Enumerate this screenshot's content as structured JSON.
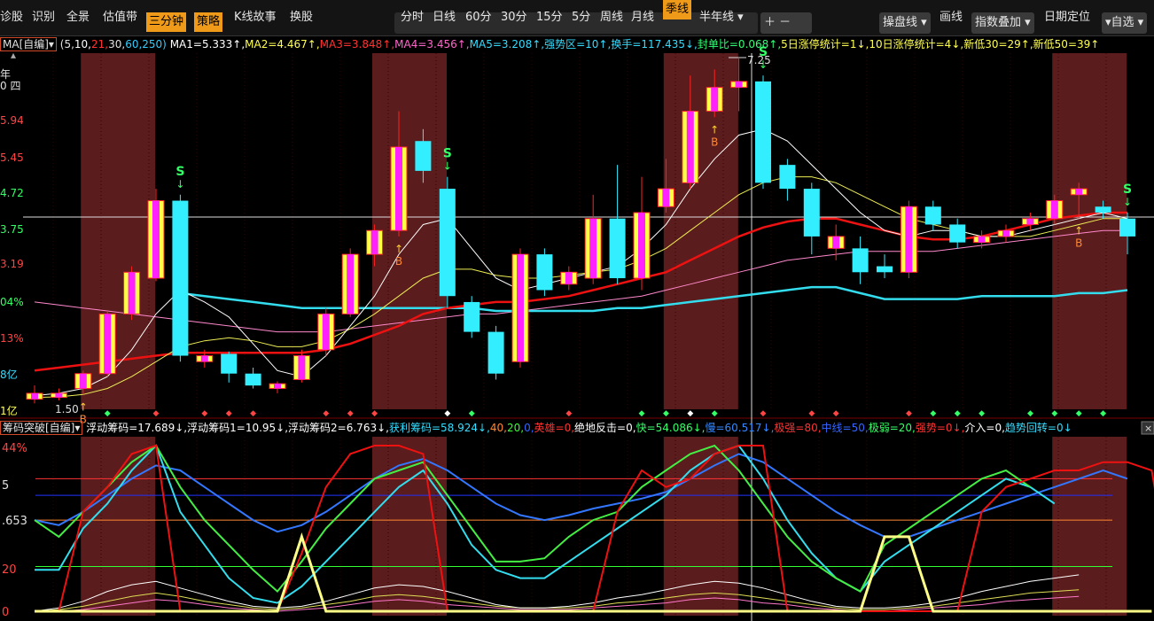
{
  "toolbar": {
    "left": [
      "诊股",
      "识别",
      "全景",
      "估值带",
      "三分钟",
      "策略",
      "K线故事",
      "换股"
    ],
    "active_left": [
      "三分钟",
      "策略"
    ],
    "periods": [
      "分时",
      "日线",
      "60分",
      "30分",
      "15分",
      "5分",
      "周线",
      "月线",
      "季线",
      "半年线"
    ],
    "active_period": "季线",
    "right": {
      "caopan": "操盘线",
      "huaxian": "画线",
      "zhishu": "指数叠加",
      "riqi": "日期定位",
      "zixuan": "自选"
    }
  },
  "legend_main": [
    {
      "t": "MA[自编]",
      "c": "#e0e0e0",
      "box": true
    },
    {
      "t": " (5,",
      "c": "#e0e0e0"
    },
    {
      "t": "10,",
      "c": "#ffffff"
    },
    {
      "t": "21,",
      "c": "#ff3333"
    },
    {
      "t": "30,",
      "c": "#e0e0e0"
    },
    {
      "t": "60,",
      "c": "#33ccff"
    },
    {
      "t": "250)",
      "c": "#33ccff"
    },
    {
      "t": "  MA1=5.333↑,",
      "c": "#ffffff"
    },
    {
      "t": "MA2=4.467↑,",
      "c": "#ffff55"
    },
    {
      "t": "MA3=3.848↑,",
      "c": "#ff3333"
    },
    {
      "t": "MA4=3.456↑,",
      "c": "#ff66cc"
    },
    {
      "t": "MA5=3.208↑,",
      "c": "#33ddff"
    },
    {
      "t": "强势区=10↑,",
      "c": "#33ddff"
    },
    {
      "t": "换手=117.435↓,",
      "c": "#33ddff"
    },
    {
      "t": "封单比=0.068↑,",
      "c": "#33ff77"
    },
    {
      "t": "5日涨停统计=1↓,",
      "c": "#ffff55"
    },
    {
      "t": "10日涨停统计=4↓,",
      "c": "#ffff55"
    },
    {
      "t": "新低30=29↑,",
      "c": "#ffff55"
    },
    {
      "t": "新低50=39↑",
      "c": "#ffff55"
    }
  ],
  "legend_ind": [
    {
      "t": "筹码突破[自编]",
      "c": "#e6e6e6",
      "box": true
    },
    {
      "t": " 浮动筹码=17.689↓,",
      "c": "#ffffff"
    },
    {
      "t": "浮动筹码1=10.95↓,",
      "c": "#ffffff"
    },
    {
      "t": "浮动筹码2=6.763↓,",
      "c": "#ffffff"
    },
    {
      "t": "获利筹码=58.924↓,",
      "c": "#33ddff"
    },
    {
      "t": "40,",
      "c": "#ff8833"
    },
    {
      "t": "20,",
      "c": "#33ff33"
    },
    {
      "t": "0,",
      "c": "#3366ff"
    },
    {
      "t": "英雄=0,",
      "c": "#ff3333"
    },
    {
      "t": "绝地反击=0,",
      "c": "#ffffff"
    },
    {
      "t": "快=54.086↓,",
      "c": "#33ff66"
    },
    {
      "t": "慢=60.517↓,",
      "c": "#3388ff"
    },
    {
      "t": "极强=80,",
      "c": "#ff3333"
    },
    {
      "t": "中线=50,",
      "c": "#3366ff"
    },
    {
      "t": "极弱=20,",
      "c": "#33ff66"
    },
    {
      "t": "强势=0↓,",
      "c": "#ff3333"
    },
    {
      "t": "介入=0,",
      "c": "#ffffff"
    },
    {
      "t": "趋势回转=0↓",
      "c": "#33ddff"
    }
  ],
  "axis_main": [
    {
      "t": "5.94",
      "c": "#ff4444"
    },
    {
      "t": "5.45",
      "c": "#ff4444"
    },
    {
      "t": "4.72",
      "c": "#33ff66"
    },
    {
      "t": "3.75",
      "c": "#33ff66"
    },
    {
      "t": "3.19",
      "c": "#ff4444"
    },
    {
      "t": "04%",
      "c": "#33ff66"
    },
    {
      "t": "13%",
      "c": "#ff4444"
    },
    {
      "t": "8亿",
      "c": "#33ddff"
    },
    {
      "t": "1亿",
      "c": "#ffff55"
    }
  ],
  "axis_top": [
    {
      "t": "年",
      "c": "#e0e0e0"
    },
    {
      "t": "0 四",
      "c": "#e0e0e0"
    }
  ],
  "axis_ind": [
    {
      "t": "44%",
      "c": "#ff4444"
    },
    {
      "t": "5",
      "c": "#e0e0e0"
    },
    {
      "t": ".653",
      "c": "#e0e0e0"
    },
    {
      "t": "20",
      "c": "#ff4444"
    },
    {
      "t": "0",
      "c": "#ff4444"
    }
  ],
  "annotations": {
    "high": "7.25",
    "low": "1.50",
    "buy": "B",
    "sell": "S"
  },
  "chart_data": {
    "type": "candlestick",
    "candles": [
      {
        "o": 1.52,
        "c": 1.62,
        "h": 1.75,
        "l": 1.45
      },
      {
        "o": 1.55,
        "c": 1.62,
        "h": 1.7,
        "l": 1.5
      },
      {
        "o": 1.7,
        "c": 1.95,
        "h": 2.0,
        "l": 1.6
      },
      {
        "o": 1.95,
        "c": 2.95,
        "h": 3.0,
        "l": 1.9
      },
      {
        "o": 2.95,
        "c": 3.65,
        "h": 3.75,
        "l": 2.85
      },
      {
        "o": 3.55,
        "c": 4.85,
        "h": 5.05,
        "l": 3.5
      },
      {
        "o": 4.85,
        "c": 2.25,
        "h": 4.95,
        "l": 2.15
      },
      {
        "o": 2.15,
        "c": 2.25,
        "h": 2.35,
        "l": 2.05
      },
      {
        "o": 2.28,
        "c": 1.95,
        "h": 2.32,
        "l": 1.8
      },
      {
        "o": 1.95,
        "c": 1.75,
        "h": 2.05,
        "l": 1.7
      },
      {
        "o": 1.7,
        "c": 1.78,
        "h": 1.82,
        "l": 1.62
      },
      {
        "o": 1.85,
        "c": 2.25,
        "h": 2.35,
        "l": 1.8
      },
      {
        "o": 2.35,
        "c": 2.95,
        "h": 3.05,
        "l": 2.25
      },
      {
        "o": 2.95,
        "c": 3.95,
        "h": 4.05,
        "l": 2.9
      },
      {
        "o": 3.95,
        "c": 4.35,
        "h": 4.45,
        "l": 3.75
      },
      {
        "o": 4.35,
        "c": 5.75,
        "h": 6.35,
        "l": 4.25
      },
      {
        "o": 5.85,
        "c": 5.35,
        "h": 6.05,
        "l": 5.15
      },
      {
        "o": 5.05,
        "c": 3.25,
        "h": 5.25,
        "l": 3.05
      },
      {
        "o": 3.15,
        "c": 2.65,
        "h": 3.25,
        "l": 2.55
      },
      {
        "o": 2.65,
        "c": 1.95,
        "h": 2.75,
        "l": 1.85
      },
      {
        "o": 2.15,
        "c": 3.95,
        "h": 4.05,
        "l": 2.05
      },
      {
        "o": 3.95,
        "c": 3.35,
        "h": 4.05,
        "l": 3.25
      },
      {
        "o": 3.45,
        "c": 3.65,
        "h": 3.75,
        "l": 3.35
      },
      {
        "o": 3.55,
        "c": 4.55,
        "h": 4.95,
        "l": 3.45
      },
      {
        "o": 4.55,
        "c": 3.55,
        "h": 5.45,
        "l": 3.45
      },
      {
        "o": 3.55,
        "c": 4.65,
        "h": 5.25,
        "l": 3.35
      },
      {
        "o": 4.75,
        "c": 5.05,
        "h": 5.55,
        "l": 4.65
      },
      {
        "o": 5.15,
        "c": 6.35,
        "h": 6.95,
        "l": 5.05
      },
      {
        "o": 6.35,
        "c": 6.75,
        "h": 7.05,
        "l": 6.25
      },
      {
        "o": 6.75,
        "c": 6.85,
        "h": 7.25,
        "l": 6.35
      },
      {
        "o": 6.85,
        "c": 5.15,
        "h": 6.95,
        "l": 5.05
      },
      {
        "o": 5.45,
        "c": 5.05,
        "h": 5.55,
        "l": 4.85
      },
      {
        "o": 5.05,
        "c": 4.25,
        "h": 5.15,
        "l": 3.95
      },
      {
        "o": 4.05,
        "c": 4.25,
        "h": 4.45,
        "l": 3.85
      },
      {
        "o": 4.05,
        "c": 3.65,
        "h": 4.25,
        "l": 3.45
      },
      {
        "o": 3.75,
        "c": 3.65,
        "h": 3.95,
        "l": 3.55
      },
      {
        "o": 3.65,
        "c": 4.75,
        "h": 4.85,
        "l": 3.55
      },
      {
        "o": 4.75,
        "c": 4.45,
        "h": 4.85,
        "l": 4.35
      },
      {
        "o": 4.45,
        "c": 4.15,
        "h": 4.55,
        "l": 4.05
      },
      {
        "o": 4.15,
        "c": 4.25,
        "h": 4.35,
        "l": 4.05
      },
      {
        "o": 4.25,
        "c": 4.35,
        "h": 4.45,
        "l": 4.15
      },
      {
        "o": 4.45,
        "c": 4.55,
        "h": 4.65,
        "l": 4.35
      },
      {
        "o": 4.55,
        "c": 4.85,
        "h": 4.95,
        "l": 4.45
      },
      {
        "o": 4.95,
        "c": 5.05,
        "h": 5.15,
        "l": 4.55
      },
      {
        "o": 4.75,
        "c": 4.65,
        "h": 4.85,
        "l": 4.55
      },
      {
        "o": 4.55,
        "c": 4.25,
        "h": 4.65,
        "l": 3.95
      }
    ],
    "shaded_bars": [
      3,
      15,
      27,
      43
    ],
    "buy_bars": [
      2,
      15,
      28,
      43
    ],
    "sell_bars": [
      6,
      17,
      30,
      45
    ],
    "ma_white": [
      1.58,
      1.62,
      1.7,
      1.9,
      2.35,
      2.95,
      3.35,
      3.15,
      2.9,
      2.45,
      2.0,
      1.9,
      2.25,
      2.75,
      3.25,
      3.95,
      4.45,
      4.55,
      4.05,
      3.55,
      3.35,
      3.45,
      3.55,
      3.65,
      3.75,
      4.05,
      4.45,
      5.05,
      5.55,
      5.95,
      6.05,
      5.85,
      5.45,
      5.05,
      4.65,
      4.35,
      4.25,
      4.35,
      4.35,
      4.25,
      4.25,
      4.35,
      4.45,
      4.55,
      4.65,
      4.55
    ],
    "ma_yellow": [
      1.55,
      1.56,
      1.6,
      1.7,
      1.9,
      2.15,
      2.4,
      2.5,
      2.55,
      2.5,
      2.4,
      2.4,
      2.5,
      2.7,
      2.95,
      3.25,
      3.55,
      3.7,
      3.7,
      3.6,
      3.55,
      3.55,
      3.6,
      3.65,
      3.7,
      3.85,
      4.05,
      4.35,
      4.65,
      4.95,
      5.15,
      5.25,
      5.25,
      5.15,
      4.95,
      4.75,
      4.55,
      4.45,
      4.35,
      4.25,
      4.25,
      4.25,
      4.35,
      4.45,
      4.55,
      4.55
    ],
    "ma_red": [
      2.0,
      2.05,
      2.1,
      2.15,
      2.2,
      2.25,
      2.3,
      2.3,
      2.3,
      2.3,
      2.3,
      2.3,
      2.35,
      2.45,
      2.6,
      2.75,
      2.95,
      3.05,
      3.1,
      3.15,
      3.15,
      3.2,
      3.25,
      3.35,
      3.45,
      3.55,
      3.65,
      3.85,
      4.05,
      4.25,
      4.4,
      4.5,
      4.55,
      4.55,
      4.45,
      4.35,
      4.25,
      4.2,
      4.2,
      4.25,
      4.35,
      4.45,
      4.55,
      4.6,
      4.65,
      4.65
    ],
    "ma_pink": [
      3.15,
      3.1,
      3.05,
      3.0,
      2.95,
      2.9,
      2.85,
      2.8,
      2.75,
      2.7,
      2.65,
      2.65,
      2.65,
      2.7,
      2.75,
      2.8,
      2.85,
      2.9,
      2.95,
      2.95,
      3.0,
      3.05,
      3.1,
      3.15,
      3.2,
      3.25,
      3.35,
      3.45,
      3.55,
      3.65,
      3.75,
      3.85,
      3.9,
      3.95,
      4.0,
      4.0,
      4.0,
      4.0,
      4.05,
      4.1,
      4.15,
      4.2,
      4.25,
      4.3,
      4.35,
      4.35
    ],
    "ma_cyan": [
      null,
      null,
      null,
      null,
      null,
      null,
      3.3,
      3.25,
      3.2,
      3.15,
      3.1,
      3.05,
      3.05,
      3.05,
      3.05,
      3.05,
      3.05,
      3.05,
      3.05,
      3.0,
      3.0,
      3.0,
      3.0,
      3.0,
      3.05,
      3.05,
      3.1,
      3.15,
      3.2,
      3.25,
      3.3,
      3.35,
      3.4,
      3.4,
      3.3,
      3.2,
      3.2,
      3.2,
      3.2,
      3.25,
      3.25,
      3.25,
      3.25,
      3.3,
      3.3,
      3.35
    ],
    "ind": {
      "ylim": [
        0,
        100
      ],
      "hlines": [
        {
          "v": 80,
          "c": "#ff3333"
        },
        {
          "v": 70,
          "c": "#2233ff"
        },
        {
          "v": 55,
          "c": "#ff8833"
        },
        {
          "v": 27,
          "c": "#33ff33"
        }
      ],
      "red": [
        0,
        0,
        60,
        75,
        95,
        100,
        0,
        0,
        0,
        0,
        0,
        35,
        75,
        95,
        100,
        100,
        95,
        0,
        0,
        0,
        0,
        0,
        0,
        0,
        60,
        85,
        75,
        80,
        95,
        100,
        100,
        0,
        0,
        0,
        0,
        0,
        0,
        0,
        0,
        60,
        75,
        80,
        85,
        85,
        90,
        90,
        85,
        0
      ],
      "green": [
        55,
        45,
        60,
        75,
        90,
        100,
        75,
        55,
        40,
        25,
        12,
        30,
        50,
        65,
        80,
        85,
        90,
        70,
        50,
        30,
        30,
        32,
        45,
        55,
        60,
        75,
        85,
        95,
        100,
        85,
        65,
        45,
        30,
        20,
        12,
        40,
        50,
        60,
        70,
        80,
        85,
        75
      ],
      "cyan": [
        25,
        25,
        50,
        65,
        85,
        100,
        60,
        40,
        20,
        8,
        5,
        15,
        30,
        45,
        60,
        75,
        85,
        65,
        40,
        25,
        20,
        20,
        30,
        40,
        50,
        60,
        70,
        85,
        95,
        100,
        80,
        55,
        35,
        20,
        12,
        30,
        40,
        50,
        60,
        70,
        80,
        75,
        65
      ],
      "blue": [
        55,
        52,
        60,
        70,
        80,
        88,
        85,
        75,
        65,
        55,
        48,
        52,
        60,
        70,
        80,
        88,
        92,
        85,
        75,
        65,
        58,
        55,
        58,
        62,
        65,
        68,
        72,
        80,
        88,
        95,
        90,
        80,
        70,
        60,
        52,
        45,
        45,
        50,
        55,
        60,
        65,
        70,
        75,
        80,
        85,
        80
      ],
      "yellow": [
        0,
        0,
        0,
        0,
        0,
        0,
        0,
        0,
        0,
        0,
        0,
        45,
        0,
        0,
        0,
        0,
        0,
        0,
        0,
        0,
        0,
        0,
        0,
        0,
        0,
        0,
        0,
        0,
        0,
        0,
        0,
        0,
        0,
        0,
        0,
        45,
        45,
        0,
        0,
        0,
        0,
        0,
        0,
        0,
        0,
        0,
        0
      ],
      "white": [
        0,
        2,
        6,
        12,
        16,
        18,
        14,
        10,
        6,
        3,
        2,
        3,
        6,
        10,
        14,
        16,
        15,
        12,
        8,
        4,
        2,
        2,
        3,
        5,
        8,
        10,
        13,
        16,
        18,
        17,
        14,
        10,
        6,
        3,
        2,
        2,
        3,
        5,
        8,
        12,
        15,
        18,
        20,
        22
      ],
      "yel2": [
        0,
        1,
        3,
        6,
        9,
        11,
        9,
        6,
        4,
        2,
        1,
        2,
        4,
        6,
        9,
        10,
        9,
        7,
        5,
        3,
        2,
        2,
        2,
        3,
        5,
        6,
        8,
        10,
        11,
        10,
        8,
        6,
        4,
        2,
        1,
        1,
        2,
        3,
        5,
        7,
        9,
        11,
        12,
        13
      ],
      "pink": [
        0,
        0,
        1,
        3,
        5,
        7,
        6,
        4,
        2,
        1,
        0,
        1,
        2,
        4,
        6,
        7,
        6,
        4,
        3,
        2,
        1,
        1,
        1,
        2,
        3,
        4,
        5,
        7,
        8,
        7,
        5,
        4,
        2,
        1,
        0,
        0,
        1,
        2,
        3,
        4,
        6,
        7,
        8,
        9
      ]
    }
  }
}
